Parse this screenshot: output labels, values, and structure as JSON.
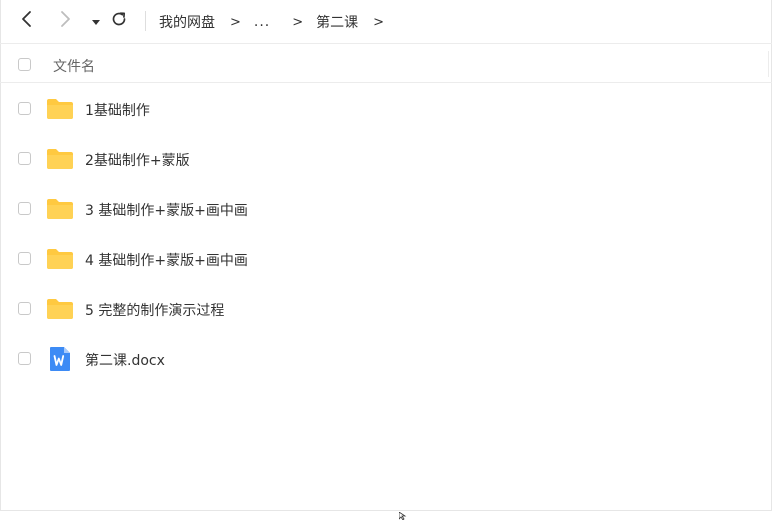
{
  "toolbar": {
    "breadcrumbs": [
      "我的网盘",
      "...",
      "第二课"
    ],
    "separator": ">"
  },
  "header": {
    "column_filename": "文件名"
  },
  "files": [
    {
      "name": "1基础制作",
      "type": "folder"
    },
    {
      "name": "2基础制作+蒙版",
      "type": "folder"
    },
    {
      "name": "3 基础制作+蒙版+画中画",
      "type": "folder"
    },
    {
      "name": "4 基础制作+蒙版+画中画",
      "type": "folder"
    },
    {
      "name": "5 完整的制作演示过程",
      "type": "folder"
    },
    {
      "name": "第二课.docx",
      "type": "docx"
    }
  ],
  "colors": {
    "folder": "#FFC940",
    "docx": "#3D8BF5"
  },
  "icons": [
    "back-arrow-icon",
    "forward-arrow-icon",
    "dropdown-triangle-icon",
    "refresh-icon",
    "folder-icon",
    "word-document-icon"
  ]
}
